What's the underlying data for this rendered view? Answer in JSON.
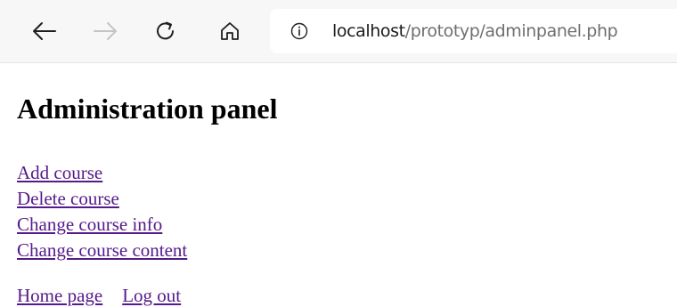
{
  "browser": {
    "url_host": "localhost",
    "url_path": "/prototyp/adminpanel.php",
    "icons": {
      "back": "arrow-left-icon",
      "forward": "arrow-right-icon",
      "reload": "reload-icon",
      "home": "home-icon",
      "info": "info-icon"
    }
  },
  "page": {
    "title": "Administration panel",
    "menu": [
      {
        "label": "Add course"
      },
      {
        "label": "Delete course"
      },
      {
        "label": "Change course info"
      },
      {
        "label": "Change course content"
      }
    ],
    "footer": [
      {
        "label": "Home page"
      },
      {
        "label": "Log out"
      }
    ]
  },
  "colors": {
    "link": "#551a8b",
    "toolbar": "#f7f7f7"
  }
}
